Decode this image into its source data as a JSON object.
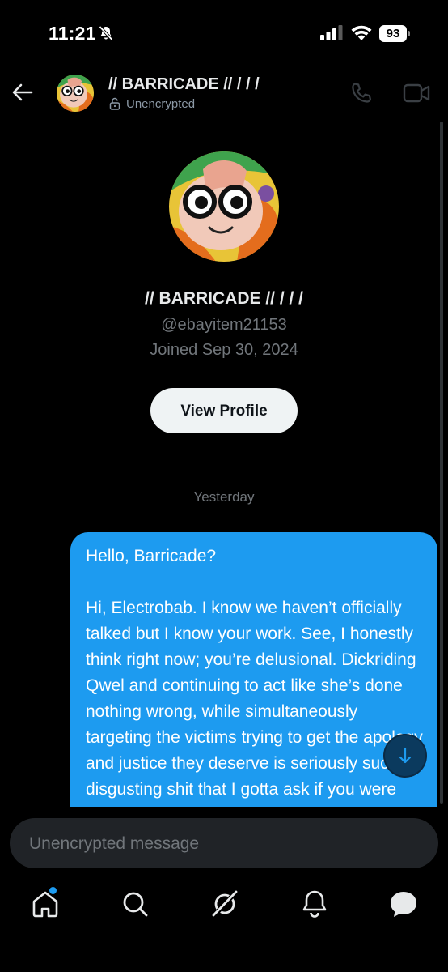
{
  "status_bar": {
    "time": "11:21",
    "battery": "93"
  },
  "header": {
    "name": "// BARRICADE // / / /",
    "encryption_status": "Unencrypted"
  },
  "profile": {
    "name": "// BARRICADE // / / /",
    "handle": "@ebayitem21153",
    "joined": "Joined Sep 30, 2024",
    "view_profile_label": "View Profile"
  },
  "conversation": {
    "day_separator": "Yesterday",
    "messages": [
      {
        "paragraphs": [
          "Hello, Barricade?",
          "Hi, Electrobab. I know we haven’t officially talked but I know your work. See, I honestly think right now; you’re delusional. Dickriding Qwel and continuing to act like she’s done nothing wrong, while simultaneously targeting the victims trying to get the apology and justice they deserve is seriously such disgusting shit that I gotta ask if you were"
        ]
      }
    ]
  },
  "composer": {
    "placeholder": "Unencrypted message"
  },
  "tab_bar": {
    "items": [
      "home-icon",
      "search-icon",
      "grok-icon",
      "notifications-icon",
      "messages-icon"
    ],
    "home_has_badge": true
  },
  "colors": {
    "accent": "#1d9bf0",
    "background": "#000000",
    "secondary_text": "#71767b"
  }
}
